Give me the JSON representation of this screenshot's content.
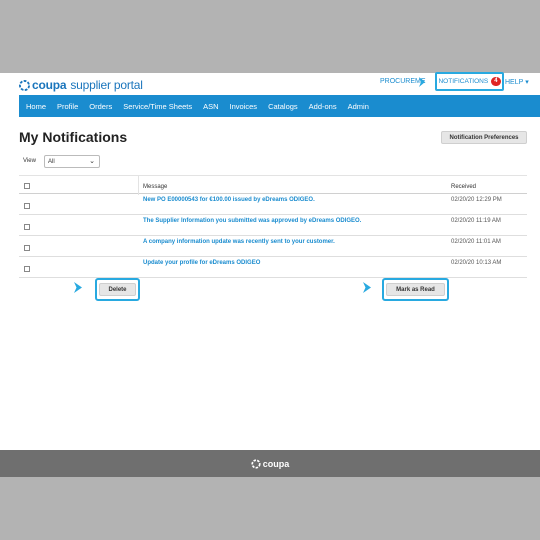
{
  "header": {
    "logo_brand": "coupa",
    "logo_product": "supplier portal",
    "procurement_label": "PROCUREME",
    "notifications_label": "NOTIFICATIONS",
    "notifications_count": "4",
    "help_label": "HELP"
  },
  "nav": {
    "items": [
      "Home",
      "Profile",
      "Orders",
      "Service/Time Sheets",
      "ASN",
      "Invoices",
      "Catalogs",
      "Add-ons",
      "Admin"
    ]
  },
  "main": {
    "title": "My Notifications",
    "preferences_button": "Notification Preferences",
    "view_label": "View",
    "view_value": "All"
  },
  "table": {
    "headers": {
      "message": "Message",
      "received": "Received"
    },
    "rows": [
      {
        "message": "New PO E00000543 for €100.00 issued by eDreams ODIGEO.",
        "received": "02/20/20 12:29 PM"
      },
      {
        "message": "The Supplier Information you submitted was approved by eDreams ODIGEO.",
        "received": "02/20/20 11:19 AM"
      },
      {
        "message": "A company information update was recently sent to your customer.",
        "received": "02/20/20 11:01 AM"
      },
      {
        "message": "Update your profile for eDreams ODIGEO",
        "received": "02/20/20 10:13 AM"
      }
    ]
  },
  "actions": {
    "delete_label": "Delete",
    "mark_read_label": "Mark as Read"
  },
  "footer": {
    "brand": "coupa"
  },
  "colors": {
    "brand_blue": "#1a8ccf",
    "callout_blue": "#28a9e0",
    "badge_red": "#e02424",
    "footer_gray": "#6f6f6f",
    "band_gray": "#b3b3b3"
  }
}
